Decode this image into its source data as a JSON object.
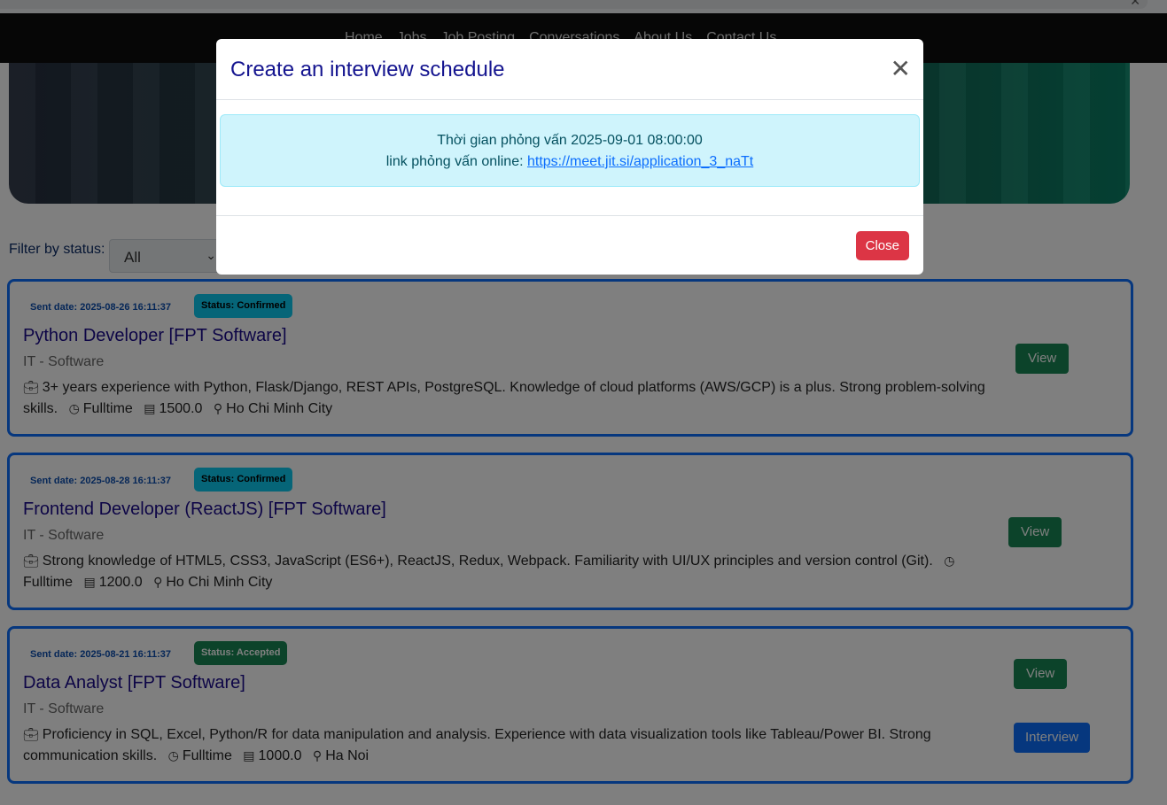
{
  "browser": {
    "close_glyph": "✕"
  },
  "nav": {
    "links": [
      "Home",
      "Jobs",
      "Job Posting",
      "Conversations",
      "About Us",
      "Contact Us"
    ]
  },
  "filter": {
    "label": "Filter by status:",
    "selected": "All"
  },
  "applications": [
    {
      "sent_date": "Sent date: 2025-08-26 16:11:37",
      "status": "Status: Confirmed",
      "title": "Python Developer [FPT Software]",
      "category": "IT - Software",
      "description": "3+ years experience with Python, Flask/Django, REST APIs, PostgreSQL. Knowledge of cloud platforms (AWS/GCP) is a plus. Strong problem-solving skills.",
      "job_type": "Fulltime",
      "salary": "1500.0",
      "location": "Ho Chi Minh City",
      "view_label": "View"
    },
    {
      "sent_date": "Sent date: 2025-08-28 16:11:37",
      "status": "Status: Confirmed",
      "title": "Frontend Developer (ReactJS) [FPT Software]",
      "category": "IT - Software",
      "description": "Strong knowledge of HTML5, CSS3, JavaScript (ES6+), ReactJS, Redux, Webpack. Familiarity with UI/UX principles and version control (Git).",
      "job_type": "Fulltime",
      "salary": "1200.0",
      "location": "Ho Chi Minh City",
      "view_label": "View"
    },
    {
      "sent_date": "Sent date: 2025-08-21 16:11:37",
      "status": "Status: Accepted",
      "title": "Data Analyst [FPT Software]",
      "category": "IT - Software",
      "description": "Proficiency in SQL, Excel, Python/R for data manipulation and analysis. Experience with data visualization tools like Tableau/Power BI. Strong communication skills.",
      "job_type": "Fulltime",
      "salary": "1000.0",
      "location": "Ha Noi",
      "view_label": "View",
      "interview_label": "Interview"
    }
  ],
  "modal": {
    "title": "Create an interview schedule",
    "close_glyph": "✕",
    "time_text": "Thời gian phỏng vấn 2025-09-01 08:00:00",
    "link_prefix": "link phỏng vấn online:",
    "link_url": "https://meet.jit.si/application_3_naTt",
    "close_label": "Close"
  },
  "colors": {
    "primary": "#0d6efd",
    "success": "#198754",
    "info": "#0dcaf0",
    "danger": "#dc3545",
    "title_text": "#14148f"
  }
}
